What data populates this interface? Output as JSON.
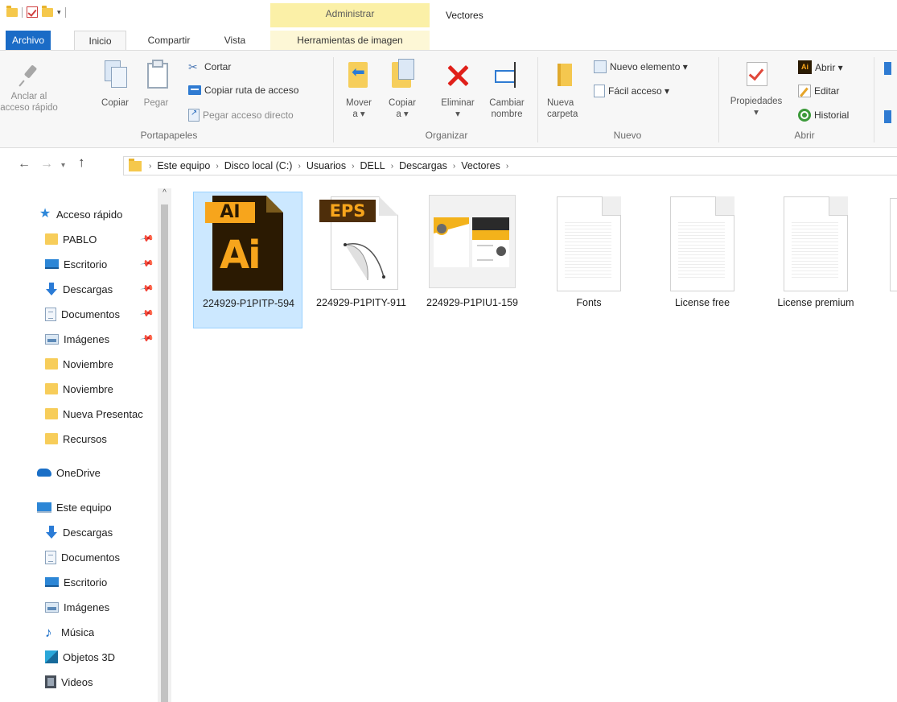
{
  "window": {
    "title": "Vectores",
    "context_tab_group": "Administrar"
  },
  "tabs": {
    "archivo": "Archivo",
    "inicio": "Inicio",
    "compartir": "Compartir",
    "vista": "Vista",
    "herramientas": "Herramientas de imagen"
  },
  "ribbon": {
    "portapapeles": {
      "label": "Portapapeles",
      "anclar": "Anclar al\nacceso rápido",
      "copiar": "Copiar",
      "pegar": "Pegar",
      "cortar": "Cortar",
      "copiar_ruta": "Copiar ruta de acceso",
      "pegar_acceso": "Pegar acceso directo"
    },
    "organizar": {
      "label": "Organizar",
      "mover": "Mover\na ▾",
      "copiar_a": "Copiar\na ▾",
      "eliminar": "Eliminar\n▾",
      "cambiar": "Cambiar\nnombre"
    },
    "nuevo": {
      "label": "Nuevo",
      "nueva_carpeta": "Nueva\ncarpeta",
      "nuevo_elemento": "Nuevo elemento ▾",
      "facil_acceso": "Fácil acceso ▾"
    },
    "abrir": {
      "label": "Abrir",
      "propiedades": "Propiedades\n▾",
      "abrir": "Abrir ▾",
      "editar": "Editar",
      "historial": "Historial",
      "ai_badge": "Ai"
    }
  },
  "address": {
    "crumbs": [
      "Este equipo",
      "Disco local (C:)",
      "Usuarios",
      "DELL",
      "Descargas",
      "Vectores"
    ],
    "separator": "›"
  },
  "nav": {
    "quick_access": "Acceso rápido",
    "items": [
      {
        "label": "PABLO",
        "icon": "folder-icon",
        "pinned": true
      },
      {
        "label": "Escritorio",
        "icon": "desktop-icon",
        "pinned": true
      },
      {
        "label": "Descargas",
        "icon": "downloads-icon",
        "pinned": true
      },
      {
        "label": "Documentos",
        "icon": "documents-icon",
        "pinned": true
      },
      {
        "label": "Imágenes",
        "icon": "pictures-icon",
        "pinned": true
      },
      {
        "label": "Noviembre",
        "icon": "folder-icon",
        "pinned": false
      },
      {
        "label": "Noviembre",
        "icon": "folder-icon",
        "pinned": false
      },
      {
        "label": "Nueva Presentac",
        "icon": "folder-icon",
        "pinned": false
      },
      {
        "label": "Recursos",
        "icon": "folder-icon",
        "pinned": false
      }
    ],
    "onedrive": "OneDrive",
    "this_pc": "Este equipo",
    "pc_items": [
      {
        "label": "Descargas",
        "icon": "downloads-icon"
      },
      {
        "label": "Documentos",
        "icon": "documents-icon"
      },
      {
        "label": "Escritorio",
        "icon": "desktop-icon"
      },
      {
        "label": "Imágenes",
        "icon": "pictures-icon"
      },
      {
        "label": "Música",
        "icon": "music-icon"
      },
      {
        "label": "Objetos 3D",
        "icon": "3d-objects-icon"
      },
      {
        "label": "Videos",
        "icon": "videos-icon"
      }
    ]
  },
  "files": [
    {
      "name": "224929-P1PITP-594",
      "type": "ai",
      "selected": true,
      "badge": "AI",
      "big": "Ai"
    },
    {
      "name": "224929-P1PITY-911",
      "type": "eps",
      "selected": false,
      "badge": "EPS"
    },
    {
      "name": "224929-P1PIU1-159",
      "type": "image",
      "selected": false
    },
    {
      "name": "Fonts",
      "type": "blank",
      "selected": false
    },
    {
      "name": "License free",
      "type": "blank",
      "selected": false
    },
    {
      "name": "License premium",
      "type": "blank",
      "selected": false
    }
  ],
  "colors": {
    "accent": "#1a6bc6",
    "context_tab": "#fbf0a7",
    "selection": "#cce8ff",
    "ai_orange": "#f7a51c",
    "ai_dark": "#2b1a02"
  }
}
